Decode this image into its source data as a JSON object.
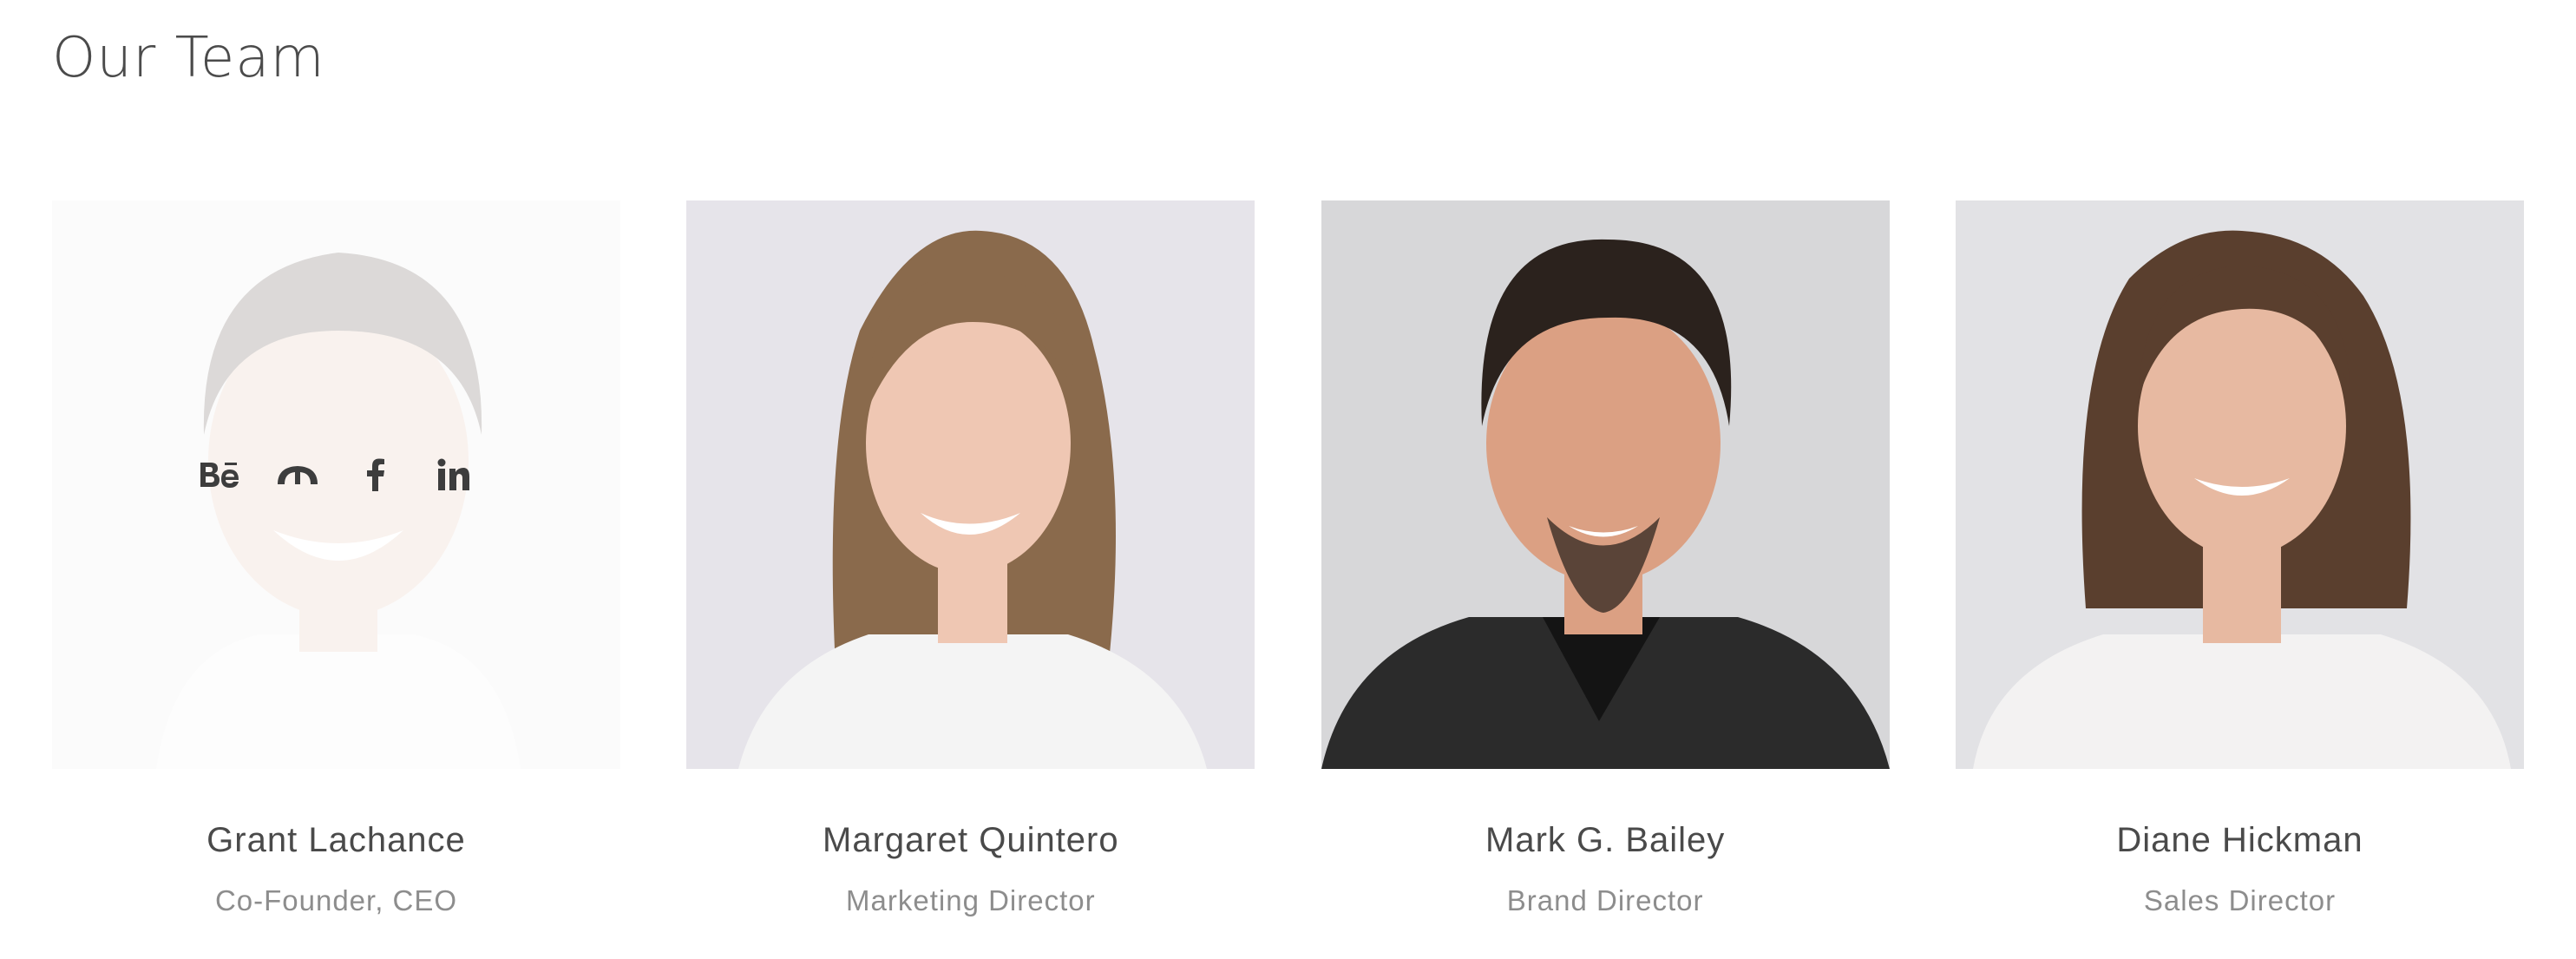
{
  "section": {
    "title": "Our Team"
  },
  "members": [
    {
      "name": "Grant Lachance",
      "role": "Co-Founder, CEO",
      "hover_state": true,
      "social": [
        "behance-icon",
        "deviantart-icon",
        "facebook-icon",
        "linkedin-icon"
      ],
      "hair": "#3c3128",
      "skin": "#ddb49e",
      "top": "#f1f1f1",
      "background": "#e9e9ea"
    },
    {
      "name": "Margaret Quintero",
      "role": "Marketing Director",
      "hover_state": false,
      "hair": "#8a6a4c",
      "skin": "#efc7b3",
      "top": "#f4f4f4",
      "background": "#e6e4ea"
    },
    {
      "name": "Mark G. Bailey",
      "role": "Brand Director",
      "hover_state": false,
      "hair": "#2b221d",
      "skin": "#dba083",
      "top": "#2b2b2b",
      "background": "#d7d7d9"
    },
    {
      "name": "Diane Hickman",
      "role": "Sales Director",
      "hover_state": false,
      "hair": "#5a3f2e",
      "skin": "#e7b9a1",
      "top": "#f3f2f2",
      "background": "#e2e2e5"
    }
  ],
  "colors": {
    "text_primary": "#4a4a4a",
    "text_secondary": "#8d8d8d",
    "icon": "#3d3d3d"
  }
}
